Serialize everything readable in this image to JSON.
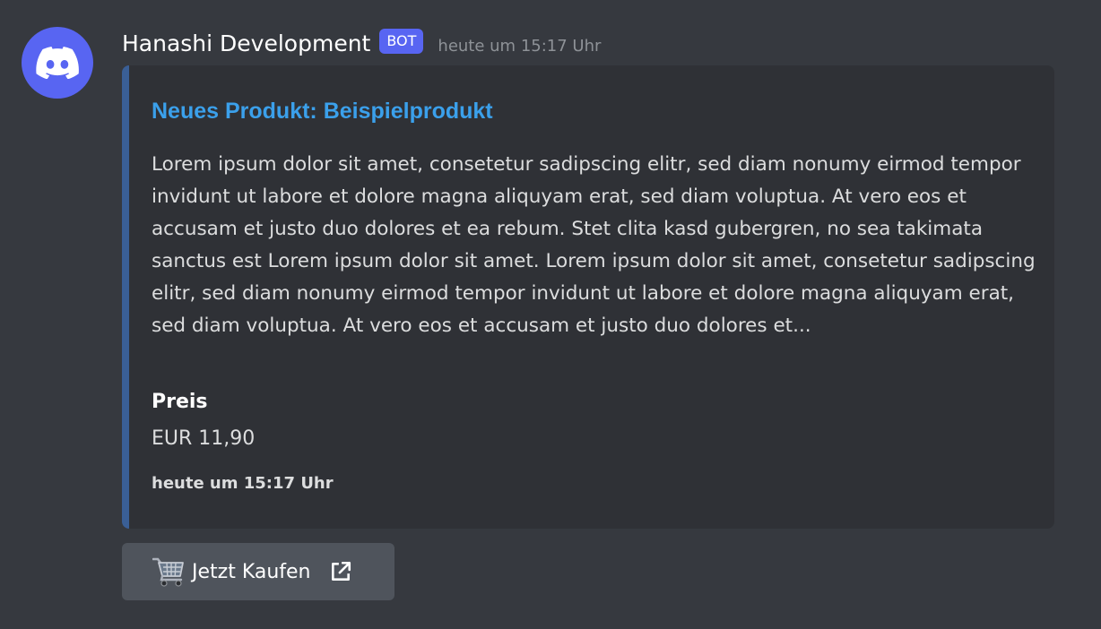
{
  "author": {
    "name": "Hanashi Development",
    "tag": "BOT",
    "timestamp": "heute um 15:17 Uhr",
    "avatar_icon": "discord-logo-icon",
    "avatar_color": "#5865f2"
  },
  "embed": {
    "accent_color": "#3a5f96",
    "title": "Neues Produkt: Beispielprodukt",
    "description": "Lorem ipsum dolor sit amet, consetetur sadipscing elitr, sed diam nonumy eirmod tempor invidunt ut labore et dolore magna aliquyam erat, sed diam voluptua. At vero eos et accusam et justo duo dolores et ea rebum. Stet clita kasd gubergren, no sea takimata sanctus est Lorem ipsum dolor sit amet. Lorem ipsum dolor sit amet, consetetur sadipscing elitr, sed diam nonumy eirmod tempor invidunt ut labore et dolore magna aliquyam erat, sed diam voluptua. At vero eos et accusam et justo duo dolores et...",
    "fields": [
      {
        "name": "Preis",
        "value": "EUR 11,90"
      }
    ],
    "footer": "heute um 15:17 Uhr"
  },
  "button": {
    "emoji": "🛒",
    "label": "Jetzt Kaufen",
    "icon": "external-link-icon"
  }
}
